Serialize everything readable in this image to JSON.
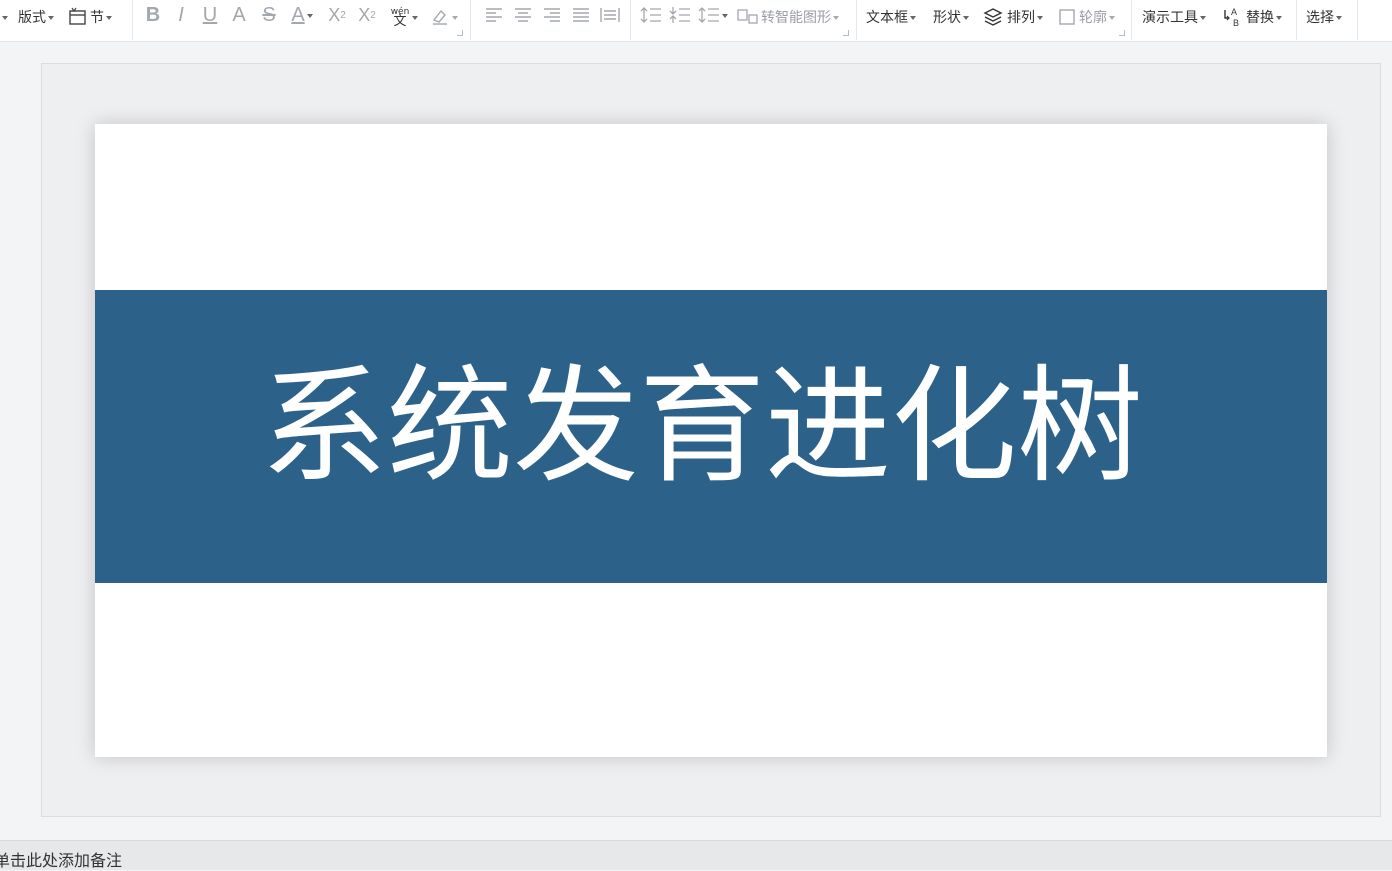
{
  "toolbar": {
    "layout_label": "版式",
    "section_label": "节",
    "phonetic_label": "wén 文",
    "smartart_label": "转智能图形",
    "textbox_label": "文本框",
    "shape_label": "形状",
    "arrange_label": "排列",
    "outline_label": "轮廓",
    "present_tools_label": "演示工具",
    "replace_label": "替换",
    "select_label": "选择"
  },
  "slide": {
    "title": "系统发育进化树",
    "band_color": "#2c628a"
  },
  "notes": {
    "placeholder": "单击此处添加备注"
  }
}
